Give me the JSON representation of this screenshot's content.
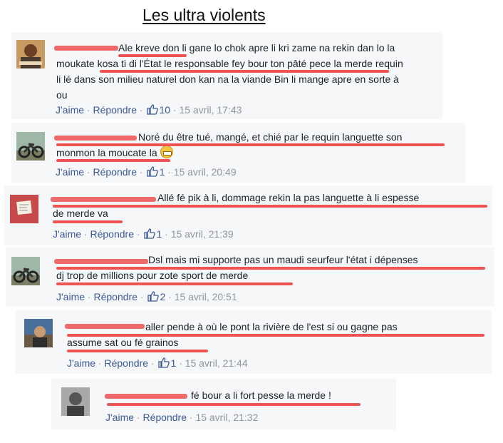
{
  "title": "Les ultra violents",
  "actions": {
    "like": "J'aime",
    "reply": "Répondre",
    "sep": "·"
  },
  "comments": [
    {
      "lines": [
        "Ale kreve don li gane lo chok apre li kri zame na rekin dan lo la",
        "moukate kosa ti di l'État le responsable fey bour ton pâté pece la merde requin",
        "li lé dans son milieu naturel don kan na la viande Bin li mange apre en sorte à",
        "ou"
      ],
      "likes": "10",
      "date": "15 avril, 17:43"
    },
    {
      "lines": [
        "Noré du être tué, mangé, et chié par le requin languette son",
        "monmon la moucate la"
      ],
      "emoji": "grimacing-emoji",
      "likes": "1",
      "date": "15 avril, 20:49"
    },
    {
      "lines": [
        "Allé fé pik à li, dommage rekin la pas languette à li espesse",
        "de merde va"
      ],
      "likes": "1",
      "date": "15 avril, 21:39"
    },
    {
      "lines": [
        "Dsl mais mi supporte pas un maudi seurfeur l'état i dépenses",
        "dj trop de millions pour zote sport de merde"
      ],
      "likes": "2",
      "date": "15 avril, 20:51"
    },
    {
      "lines": [
        "aller pende à où le pont la rivière de l'est si ou gagne pas",
        "assume sat ou fé grainos"
      ],
      "likes": "1",
      "date": "15 avril, 21:44"
    },
    {
      "lines": [
        "fé bour a li fort pesse la merde !"
      ],
      "date": "15 avril, 21:32"
    }
  ],
  "colors": {
    "link": "#3b5998",
    "meta": "#90949c",
    "highlight": "#ee5454",
    "card": "#f6f7f9"
  }
}
